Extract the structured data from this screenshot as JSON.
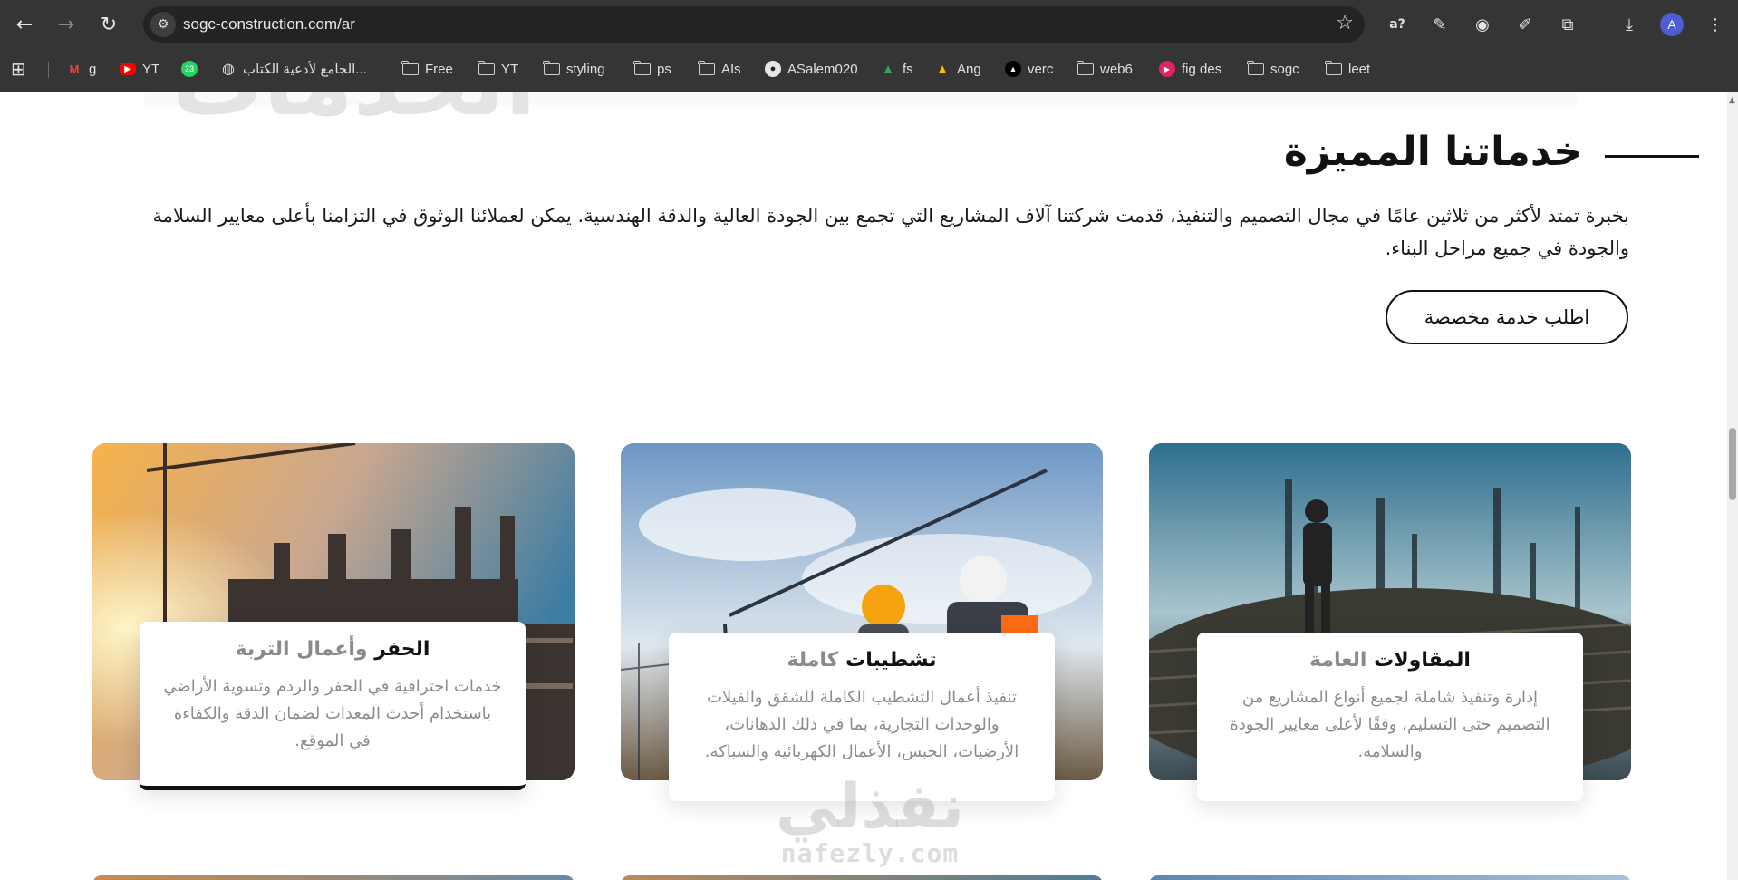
{
  "browser": {
    "url": "sogc-construction.com/ar",
    "profile_initial": "A",
    "bookmarks": [
      {
        "label": "g",
        "icon": "gmail-icon"
      },
      {
        "label": "YT",
        "icon": "youtube-icon"
      },
      {
        "label": "",
        "icon": "whatsapp-icon",
        "badge": "23"
      },
      {
        "label": "الجامع لأدعية الكتاب...",
        "icon": "globe-icon"
      },
      {
        "label": "Free",
        "icon": "folder-icon"
      },
      {
        "label": "YT",
        "icon": "folder-icon"
      },
      {
        "label": "styling",
        "icon": "folder-icon"
      },
      {
        "label": "ps",
        "icon": "folder-icon"
      },
      {
        "label": "AIs",
        "icon": "folder-icon"
      },
      {
        "label": "ASalem020",
        "icon": "github-icon"
      },
      {
        "label": "fs",
        "icon": "google-drive-icon"
      },
      {
        "label": "Ang",
        "icon": "google-drive-icon"
      },
      {
        "label": "verc",
        "icon": "vercel-icon"
      },
      {
        "label": "web6",
        "icon": "folder-icon"
      },
      {
        "label": "fig des",
        "icon": "play-icon"
      },
      {
        "label": "sogc",
        "icon": "folder-icon"
      },
      {
        "label": "leet",
        "icon": "folder-icon"
      }
    ]
  },
  "page": {
    "bg_heading": "الخدمات",
    "section_title": "خدماتنا المميزة",
    "intro": "بخبرة تمتد لأكثر من ثلاثين عامًا في مجال التصميم والتنفيذ، قدمت شركتنا آلاف المشاريع التي تجمع بين الجودة العالية والدقة الهندسية. يمكن لعملائنا الوثوق في التزامنا بأعلى معايير السلامة والجودة في جميع مراحل البناء.",
    "cta_label": "اطلب خدمة مخصصة",
    "cards": [
      {
        "title_main": "المقاولات",
        "title_muted": "العامة",
        "description": "إدارة وتنفيذ شاملة لجميع أنواع المشاريع من التصميم حتى التسليم، وفقًا لأعلى معايير الجودة والسلامة."
      },
      {
        "title_main": "تشطيبات",
        "title_muted": "كاملة",
        "description": "تنفيذ أعمال التشطيب الكاملة للشقق والفيلات والوحدات التجارية، بما في ذلك الدهانات، الأرضيات، الجبس، الأعمال الكهربائية والسباكة."
      },
      {
        "title_main": "الحفر",
        "title_muted": "وأعمال التربة",
        "description": "خدمات احترافية في الحفر والردم وتسوية الأراضي باستخدام أحدث المعدات لضمان الدقة والكفاءة في الموقع."
      }
    ],
    "watermark": {
      "arabic": "نفذلي",
      "latin": "nafezly.com"
    }
  }
}
